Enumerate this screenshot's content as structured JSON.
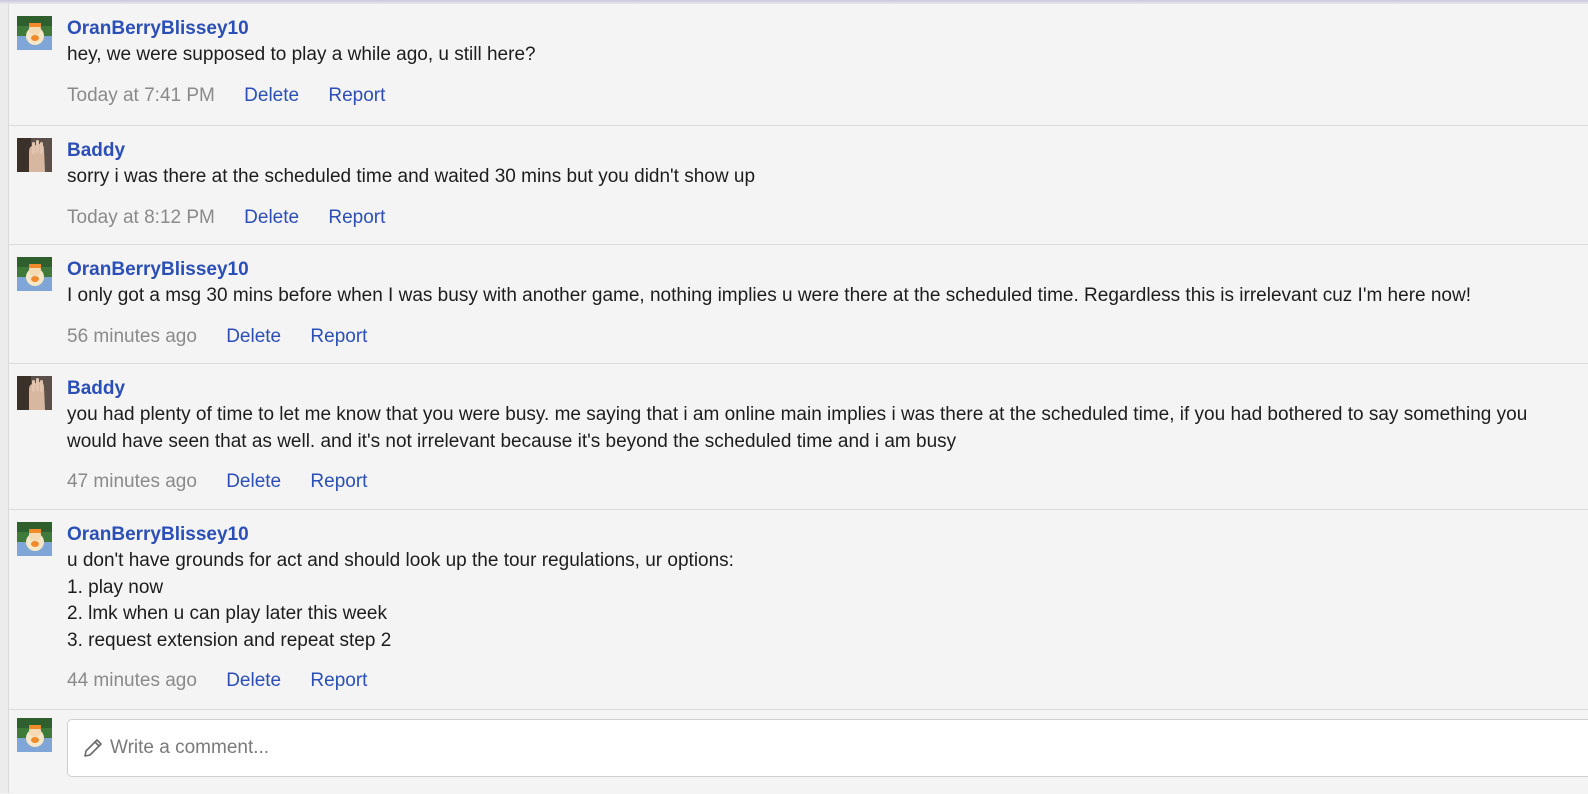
{
  "comments": [
    {
      "author": "OranBerryBlissey10",
      "avatar": "blissey-avatar",
      "body": "hey, we were supposed to play a while ago, u still here?",
      "time": "Today at 7:41 PM",
      "delete_label": "Delete",
      "report_label": "Report"
    },
    {
      "author": "Baddy",
      "avatar": "hand-avatar",
      "body": "sorry i was there at the scheduled time and waited 30 mins but you didn't show up",
      "time": "Today at 8:12 PM",
      "delete_label": "Delete",
      "report_label": "Report"
    },
    {
      "author": "OranBerryBlissey10",
      "avatar": "blissey-avatar",
      "body": "I only got a msg 30 mins before when I was busy with another game, nothing implies u were there at the scheduled time. Regardless this is irrelevant cuz I'm here now!",
      "time": "56 minutes ago",
      "delete_label": "Delete",
      "report_label": "Report"
    },
    {
      "author": "Baddy",
      "avatar": "hand-avatar",
      "body": "you had plenty of time to let me know that you were busy. me saying that i am online main implies i was there at the scheduled time, if you had bothered to say something you would have seen that as well. and it's not irrelevant because it's beyond the scheduled time and i am busy",
      "time": "47 minutes ago",
      "delete_label": "Delete",
      "report_label": "Report"
    },
    {
      "author": "OranBerryBlissey10",
      "avatar": "blissey-avatar",
      "body": "u don't have grounds for act and should look up the tour regulations, ur options:\n1. play now\n2. lmk when u can play later this week\n3. request extension and repeat step 2",
      "time": "44 minutes ago",
      "delete_label": "Delete",
      "report_label": "Report"
    }
  ],
  "compose": {
    "placeholder": "Write a comment...",
    "icon": "pencil-icon"
  },
  "colors": {
    "link": "#2b4fb6",
    "timestamp": "#8a8a8a",
    "background": "#f4f4f4"
  }
}
